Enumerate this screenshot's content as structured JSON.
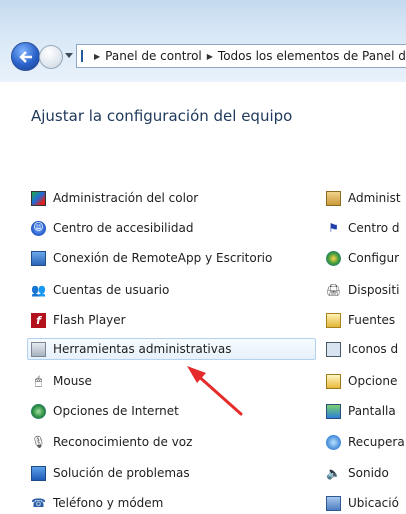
{
  "navigation": {
    "breadcrumb": [
      "Panel de control",
      "Todos los elementos de Panel de control"
    ]
  },
  "page": {
    "title": "Ajustar la configuración del equipo"
  },
  "items_left": [
    {
      "label": "Administración del color",
      "icon": "color-management-icon"
    },
    {
      "label": "Centro de accesibilidad",
      "icon": "accessibility-icon"
    },
    {
      "label": "Conexión de RemoteApp y Escritorio",
      "icon": "remote-desktop-icon"
    },
    {
      "label": "Cuentas de usuario",
      "icon": "users-icon"
    },
    {
      "label": "Flash Player",
      "icon": "flash-icon"
    },
    {
      "label": "Herramientas administrativas",
      "icon": "admin-tools-icon"
    },
    {
      "label": "Mouse",
      "icon": "mouse-icon"
    },
    {
      "label": "Opciones de Internet",
      "icon": "internet-icon"
    },
    {
      "label": "Reconocimiento de voz",
      "icon": "microphone-icon"
    },
    {
      "label": "Solución de problemas",
      "icon": "troubleshoot-icon"
    },
    {
      "label": "Teléfono y módem",
      "icon": "phone-icon"
    }
  ],
  "items_right": [
    {
      "label": "Administ",
      "icon": "admin-icon"
    },
    {
      "label": "Centro d",
      "icon": "sync-center-icon"
    },
    {
      "label": "Configur",
      "icon": "network-icon"
    },
    {
      "label": "Dispositi",
      "icon": "devices-icon"
    },
    {
      "label": "Fuentes",
      "icon": "fonts-icon"
    },
    {
      "label": "Iconos d",
      "icon": "notification-icons-icon"
    },
    {
      "label": "Opcione",
      "icon": "folder-options-icon"
    },
    {
      "label": "Pantalla",
      "icon": "display-icon"
    },
    {
      "label": "Recupera",
      "icon": "recovery-icon"
    },
    {
      "label": "Sonido",
      "icon": "sound-icon"
    },
    {
      "label": "Ubicació",
      "icon": "location-icon"
    }
  ],
  "highlighted_item": "Herramientas administrativas",
  "colors": {
    "title": "#1e395b",
    "highlight_border": "#b3d2f0",
    "arrow": "#e52b2b"
  }
}
